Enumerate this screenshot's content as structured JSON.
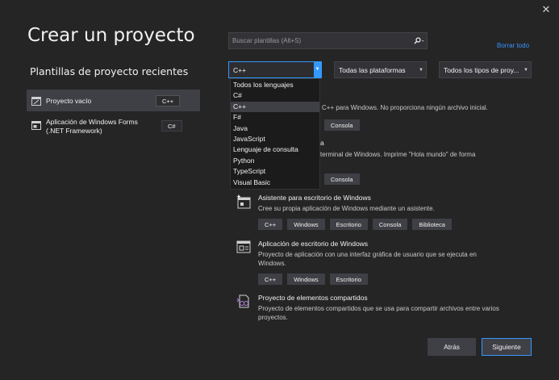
{
  "window": {
    "title": "Crear un proyecto",
    "close_glyph": "✕"
  },
  "recent": {
    "heading": "Plantillas de proyecto recientes",
    "items": [
      {
        "label": "Proyecto vacío",
        "tag": "C++",
        "icon": "empty-project-icon"
      },
      {
        "label": "Aplicación de Windows Forms (.NET Framework)",
        "tag": "C#",
        "icon": "windows-forms-icon"
      }
    ]
  },
  "search": {
    "placeholder": "Buscar plantillas (Alt+S)",
    "clear_all": "Borrar todo"
  },
  "filters": {
    "language": "C++",
    "platform": "Todas las plataformas",
    "type": "Todos los tipos de proy..."
  },
  "language_menu": {
    "options": [
      "Todos los lenguajes",
      "C#",
      "C++",
      "F#",
      "Java",
      "JavaScript",
      "Lenguaje de consulta",
      "Python",
      "TypeScript",
      "Visual Basic"
    ],
    "highlighted": "C++"
  },
  "templates": [
    {
      "name": "",
      "desc_visible": "C++ para Windows. No proporciona ningún archivo inicial.",
      "tags": [
        "Consola"
      ]
    },
    {
      "name_fragment": "a",
      "desc_visible": "terminal de Windows. Imprime \"Hola mundo\" de forma",
      "tags": [
        "Consola"
      ]
    },
    {
      "name": "Asistente para escritorio de Windows",
      "desc": "Cree su propia aplicación de Windows mediante un asistente.",
      "tags": [
        "C++",
        "Windows",
        "Escritorio",
        "Consola",
        "Biblioteca"
      ],
      "icon": "desktop-wizard-icon"
    },
    {
      "name": "Aplicación de escritorio de Windows",
      "desc": "Proyecto de aplicación con una interfaz gráfica de usuario que se ejecuta en Windows.",
      "tags": [
        "C++",
        "Windows",
        "Escritorio"
      ],
      "icon": "desktop-app-icon"
    },
    {
      "name": "Proyecto de elementos compartidos",
      "desc": "Proyecto de elementos compartidos que se usa para compartir archivos entre varios proyectos.",
      "tags": [],
      "icon": "shared-items-icon"
    }
  ],
  "buttons": {
    "back": "Atrás",
    "next": "Siguiente"
  },
  "colors": {
    "background": "#252526",
    "accent": "#3399ff",
    "link": "#3794ff",
    "tag_bg": "#3f3f46"
  }
}
